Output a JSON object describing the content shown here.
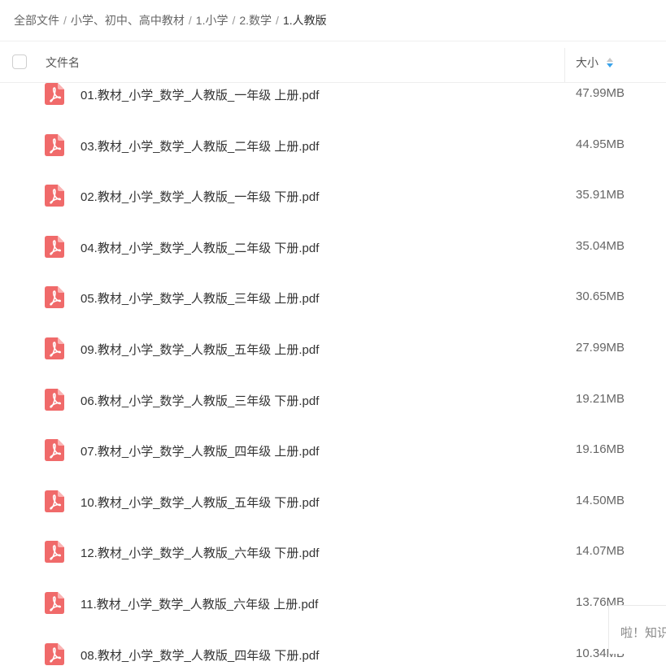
{
  "breadcrumb": {
    "items": [
      "全部文件",
      "小学、初中、高中教材",
      "1.小学",
      "2.数学",
      "1.人教版"
    ],
    "separator": "/"
  },
  "header": {
    "name_label": "文件名",
    "size_label": "大小",
    "sort_active_color": "#3aa3ea"
  },
  "files": [
    {
      "name": "01.教材_小学_数学_人教版_一年级 上册.pdf",
      "size": "47.99MB",
      "icon": "pdf-icon"
    },
    {
      "name": "03.教材_小学_数学_人教版_二年级 上册.pdf",
      "size": "44.95MB",
      "icon": "pdf-icon"
    },
    {
      "name": "02.教材_小学_数学_人教版_一年级 下册.pdf",
      "size": "35.91MB",
      "icon": "pdf-icon"
    },
    {
      "name": "04.教材_小学_数学_人教版_二年级 下册.pdf",
      "size": "35.04MB",
      "icon": "pdf-icon"
    },
    {
      "name": "05.教材_小学_数学_人教版_三年级 上册.pdf",
      "size": "30.65MB",
      "icon": "pdf-icon"
    },
    {
      "name": "09.教材_小学_数学_人教版_五年级 上册.pdf",
      "size": "27.99MB",
      "icon": "pdf-icon"
    },
    {
      "name": "06.教材_小学_数学_人教版_三年级 下册.pdf",
      "size": "19.21MB",
      "icon": "pdf-icon"
    },
    {
      "name": "07.教材_小学_数学_人教版_四年级 上册.pdf",
      "size": "19.16MB",
      "icon": "pdf-icon"
    },
    {
      "name": "10.教材_小学_数学_人教版_五年级 下册.pdf",
      "size": "14.50MB",
      "icon": "pdf-icon"
    },
    {
      "name": "12.教材_小学_数学_人教版_六年级 下册.pdf",
      "size": "14.07MB",
      "icon": "pdf-icon"
    },
    {
      "name": "11.教材_小学_数学_人教版_六年级 上册.pdf",
      "size": "13.76MB",
      "icon": "pdf-icon"
    },
    {
      "name": "08.教材_小学_数学_人教版_四年级 下册.pdf",
      "size": "10.34MB",
      "icon": "pdf-icon"
    }
  ],
  "floating_panel": {
    "text": "啦！知识"
  },
  "colors": {
    "pdf_icon": "#f06a6a"
  }
}
